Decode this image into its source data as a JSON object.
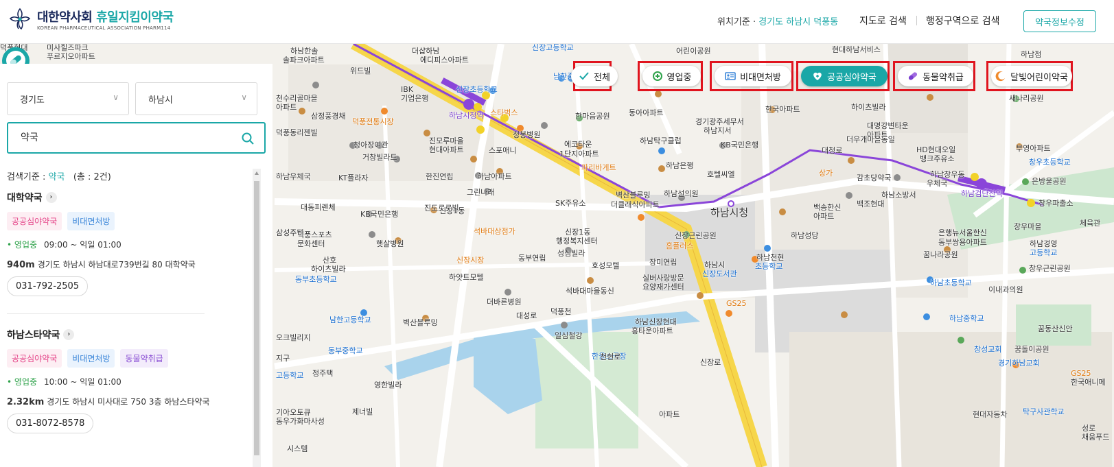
{
  "header": {
    "logo_main": "대한약사회",
    "logo_accent": "휴일지킴이약국",
    "logo_sub": "KOREAN PHARMACEUTICAL ASSOCIATION PHARM114",
    "location_prefix": "위치기준 · ",
    "location_value": "경기도 하남시 덕풍동",
    "nav_map_search": "지도로 검색",
    "nav_region_search": "행정구역으로 검색",
    "edit_button": "약국정보수정"
  },
  "sidebar": {
    "province_select": "경기도",
    "city_select": "하남시",
    "search_value": "약국",
    "criteria_label": "검색기준 : ",
    "criteria_keyword": "약국",
    "criteria_count": "(총 : 2건)",
    "results": [
      {
        "name": "대학약국",
        "tags": [
          {
            "label": "공공심야약국",
            "style": "pink"
          },
          {
            "label": "비대면처방",
            "style": "blue"
          }
        ],
        "status": "영업중",
        "hours": "09:00 ~ 익일 01:00",
        "distance": "940m",
        "address": "경기도 하남시 하남대로739번길 80 대학약국",
        "phone": "031-792-2505"
      },
      {
        "name": "하남스타약국",
        "tags": [
          {
            "label": "공공심야약국",
            "style": "pink"
          },
          {
            "label": "비대면처방",
            "style": "blue"
          },
          {
            "label": "동물약취급",
            "style": "purple"
          }
        ],
        "status": "영업중",
        "hours": "10:00 ~ 익일 01:00",
        "distance": "2.32km",
        "address": "경기도 하남시 미사대로 750 3층 하남스타약국",
        "phone": "031-8072-8578"
      }
    ]
  },
  "filters": [
    {
      "label": "전체",
      "icon": "check-icon",
      "active": false
    },
    {
      "label": "영업중",
      "icon": "plus-circle-icon",
      "active": false
    },
    {
      "label": "비대면처방",
      "icon": "id-card-icon",
      "active": false
    },
    {
      "label": "공공심야약국",
      "icon": "heart-plus-icon",
      "active": true
    },
    {
      "label": "동물약취급",
      "icon": "capsule-icon",
      "active": false
    },
    {
      "label": "달빛어린이약국",
      "icon": "moon-icon",
      "active": false
    }
  ],
  "map_labels": [
    "미사힐즈파크",
    "푸르지오아파트",
    "하남한솔",
    "솔파크아파트",
    "더샵하남",
    "에디피스아파트",
    "신장고등학교",
    "어린이공원",
    "현대하남서비스",
    "하남점",
    "위드빌",
    "IBK",
    "기업은행",
    "남한중학교",
    "신장초등학교",
    "천수리골마을",
    "아파트",
    "하남시청역",
    "스타벅스",
    "한마음공원",
    "동아아파트",
    "한국아파트",
    "하이츠빌라",
    "새나리공원",
    "삼정풍경채",
    "덕풍전통시장",
    "청봉병원",
    "경기광주세무서",
    "하남지서",
    "대명강변타운",
    "아파트",
    "덕풍동리젠빌",
    "진모루마을",
    "현대아파트",
    "에코타운",
    "1단지아파트",
    "하남탁구클럽",
    "더우개마을동일",
    "부영아파트",
    "청아장여관",
    "스포애니",
    "KB국민은행",
    "HD현대오일",
    "뱅크주유소",
    "거창빌라트",
    "한진연립",
    "하남아파트",
    "파리바게트",
    "하남은행",
    "대청로",
    "창우초등학교",
    "하남우체국",
    "KT플라자",
    "그린나래",
    "호텔씨엘",
    "상가",
    "감초당약국",
    "하남창우동",
    "우체국",
    "은방울공원",
    "SK주유소",
    "벽산블루밍",
    "더클래식아파트",
    "하남선의원",
    "하남소방서",
    "하남검단산역",
    "창우파출소",
    "대동피렌체",
    "KB국민은행",
    "진도로르빌",
    "신장1동",
    "백송한신",
    "아파트",
    "백조현대",
    "체육관",
    "하남시청",
    "신장1동",
    "행정복지센터",
    "석바대상점가",
    "삼성주택",
    "덕풍스포츠",
    "문화센터",
    "햇살병원",
    "신장근린공원",
    "하남성당",
    "창우마을",
    "은행뉴서울한신",
    "동부쌍용아파트",
    "신장시장",
    "동부연립",
    "성심빌라",
    "홈플러스",
    "하남경영",
    "고등학교",
    "하남천현",
    "초등학교",
    "꿈나라공원",
    "산호",
    "하이츠빌라",
    "호성모텔",
    "장미연립",
    "하남시",
    "신장도서관",
    "창우근린공원",
    "동부초등학교",
    "하얏트모텔",
    "실버사랑방문",
    "요양재가센터",
    "하남초등학교",
    "이내과의원",
    "더바른병원",
    "석바대마을동신",
    "GS25",
    "남한고등학교",
    "벽산블루밍",
    "대성로",
    "덕풍천",
    "하남신장현대",
    "홍타운아파트",
    "하남중학교",
    "꿈동산신안",
    "오크빌리지",
    "일심철강",
    "한울소극장",
    "창성교회",
    "꿈돌이공원",
    "동부중학교",
    "신장로",
    "천현로",
    "지구",
    "경기하남교회",
    "GS25",
    "한국애니메",
    "고등학교",
    "정주택",
    "영한빌라",
    "현대자동차",
    "탁구사관학교",
    "제너빌",
    "기아오토큐",
    "동우가화마사성",
    "아파트",
    "성로",
    "채움푸드",
    "시스템",
    "덕풍현대"
  ]
}
